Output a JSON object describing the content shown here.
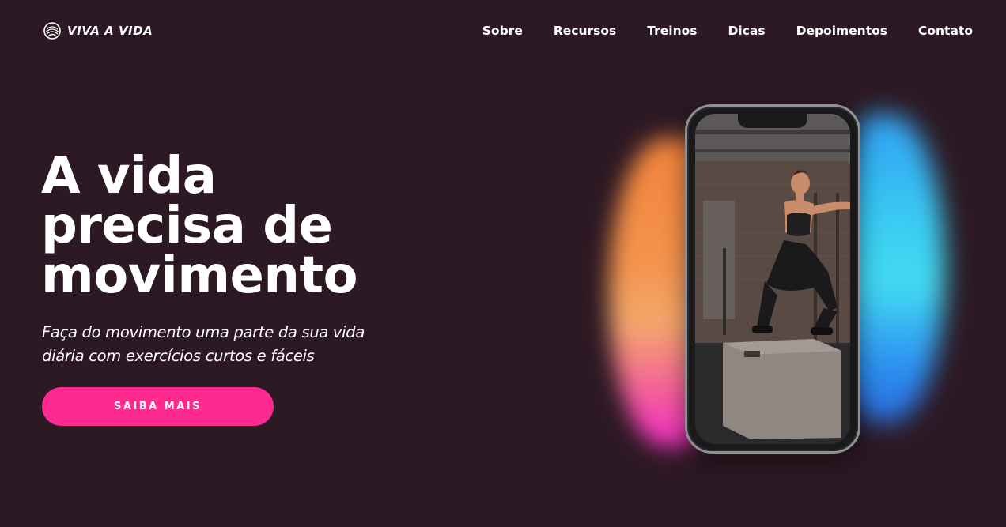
{
  "header": {
    "logo_text": "VIVA A VIDA",
    "logo_icon": "fingerprint-icon",
    "nav": [
      {
        "label": "Sobre"
      },
      {
        "label": "Recursos"
      },
      {
        "label": "Treinos"
      },
      {
        "label": "Dicas"
      },
      {
        "label": "Depoimentos"
      },
      {
        "label": "Contato"
      }
    ]
  },
  "hero": {
    "title_lines": [
      "A vida",
      "precisa de",
      "movimento"
    ],
    "subtitle": "Faça do movimento uma parte da sua vida diária com exercícios curtos e fáceis",
    "cta_label": "SAIBA MAIS"
  },
  "phone": {
    "image": "woman-box-jump-gym-photo"
  },
  "colors": {
    "background": "#2c1923",
    "accent": "#ff2a8f",
    "glow_orange": "#ff8a3d",
    "glow_blue": "#3bd6ff",
    "glow_magenta": "#ff2fd0"
  }
}
